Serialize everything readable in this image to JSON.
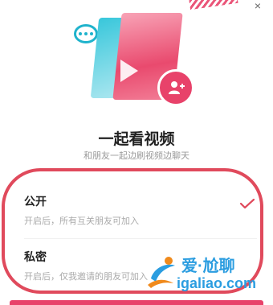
{
  "header": {
    "close_label": "×"
  },
  "hero": {
    "bubble_icon": "chat-bubble-icon",
    "avatar_icon": "user-add-icon",
    "colors": {
      "pink": "#e8426a",
      "teal": "#1fb3cc"
    }
  },
  "title": "一起看视频",
  "subtitle": "和朋友一起边刷视频边聊天",
  "options": [
    {
      "name": "公开",
      "desc": "开启后，所有互关朋友可加入",
      "selected": true
    },
    {
      "name": "私密",
      "desc": "开启后，仅我邀请的朋友可加入",
      "selected": false
    }
  ],
  "watermark": {
    "name": "爱·尬聊",
    "url": "igaliao.com"
  },
  "accent_color": "#e04a5c"
}
